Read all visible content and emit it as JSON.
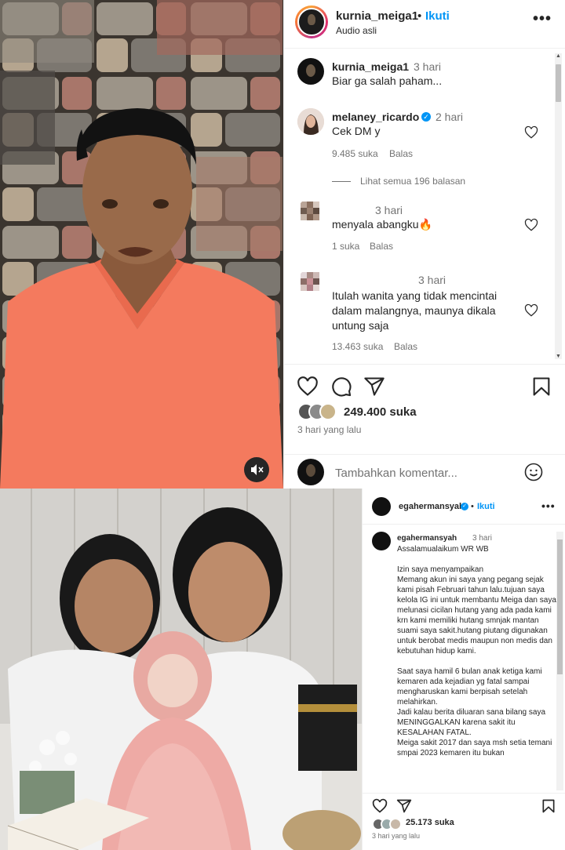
{
  "post1": {
    "username": "kurnia_meiga1",
    "dot": "•",
    "follow_label": "Ikuti",
    "audio_label": "Audio asli",
    "comments": [
      {
        "user": "kurnia_meiga1",
        "time": "3 hari",
        "text": "Biar ga salah paham..."
      },
      {
        "user": "melaney_ricardo",
        "time": "2 hari",
        "text": "Cek DM y",
        "likes": "9.485 suka",
        "reply": "Balas",
        "verified": true
      },
      {
        "view_replies": "Lihat semua 196 balasan"
      },
      {
        "user": "",
        "time": "3 hari",
        "text": "menyala abangku🔥",
        "likes": "1 suka",
        "reply": "Balas"
      },
      {
        "user": "",
        "time": "3 hari",
        "text_lines": [
          "Itulah wanita yang tidak mencintai",
          "dalam malangnya, maunya dikala",
          "untung saja"
        ],
        "likes": "13.463 suka",
        "reply": "Balas"
      }
    ],
    "likes_count": "249.400 suka",
    "date": "3 hari yang lalu",
    "add_comment_placeholder": "Tambahkan komentar..."
  },
  "post2": {
    "username": "egahermansyah",
    "dot": "•",
    "follow_label": "Ikuti",
    "caption_user": "egahermansyah",
    "caption_time": "3 hari",
    "caption_paragraphs": [
      "Assalamualaikum WR WB",
      "Izin saya menyampaikan\nMemang akun ini saya yang pegang sejak kami pisah Februari tahun lalu.tujuan saya kelola IG ini untuk membantu Meiga dan saya melunasi cicilan hutang yang ada pada kami krn kami memiliki hutang smnjak mantan suami saya sakit.hutang piutang digunakan untuk berobat medis maupun non medis dan kebutuhan hidup kami.",
      "Saat saya hamil 6 bulan anak ketiga kami kemaren ada kejadian yg fatal sampai mengharuskan kami berpisah setelah melahirkan.\nJadi kalau berita diluaran sana bilang saya MENINGGALKAN karena sakit itu KESALAHAN FATAL.\nMeiga sakit 2017 dan saya msh setia temani smpai 2023 kemaren itu bukan"
    ],
    "likes_count": "25.173 suka",
    "date": "3 hari yang lalu"
  },
  "colors": {
    "link_blue": "#0095f6",
    "muted_gray": "#737373",
    "text": "#262626"
  },
  "icons": [
    "more-icon",
    "heart-icon",
    "comment-icon",
    "share-icon",
    "bookmark-icon",
    "emoji-icon",
    "mute-icon",
    "verified-icon"
  ]
}
